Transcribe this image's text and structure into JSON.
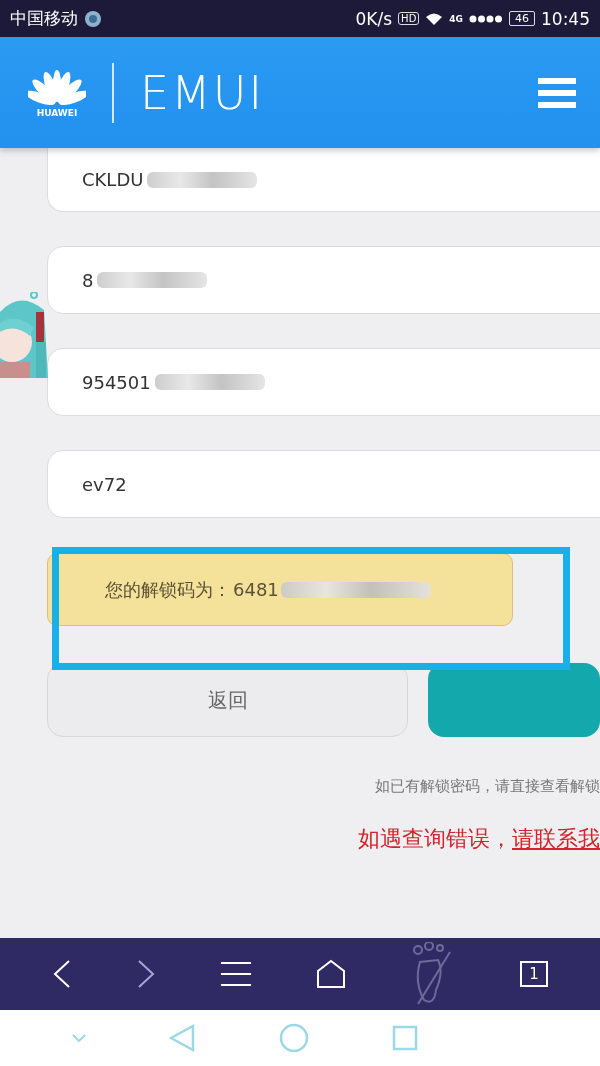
{
  "status_bar": {
    "carrier": "中国移动",
    "speed": "0K/s",
    "hd": "HD",
    "network": "4G",
    "battery": "46",
    "time": "10:45"
  },
  "header": {
    "brand": "HUAWEI",
    "title": "EMUI"
  },
  "fields": [
    {
      "value": "CKLDU",
      "blurred": true
    },
    {
      "value": "8",
      "blurred": true
    },
    {
      "value": "954501",
      "blurred": true
    },
    {
      "value": "ev72",
      "blurred": false
    }
  ],
  "result": {
    "label": "您的解锁码为：",
    "code": "6481",
    "blurred": true
  },
  "buttons": [
    {
      "kind": "secondary",
      "label": "返回"
    },
    {
      "kind": "primary"
    }
  ],
  "hint": "如已有解锁密码，请直接查看解锁",
  "error_note": {
    "text": "如遇查询错误，",
    "link": "请联系我"
  },
  "browser_bar": {
    "tab_count": "1"
  }
}
